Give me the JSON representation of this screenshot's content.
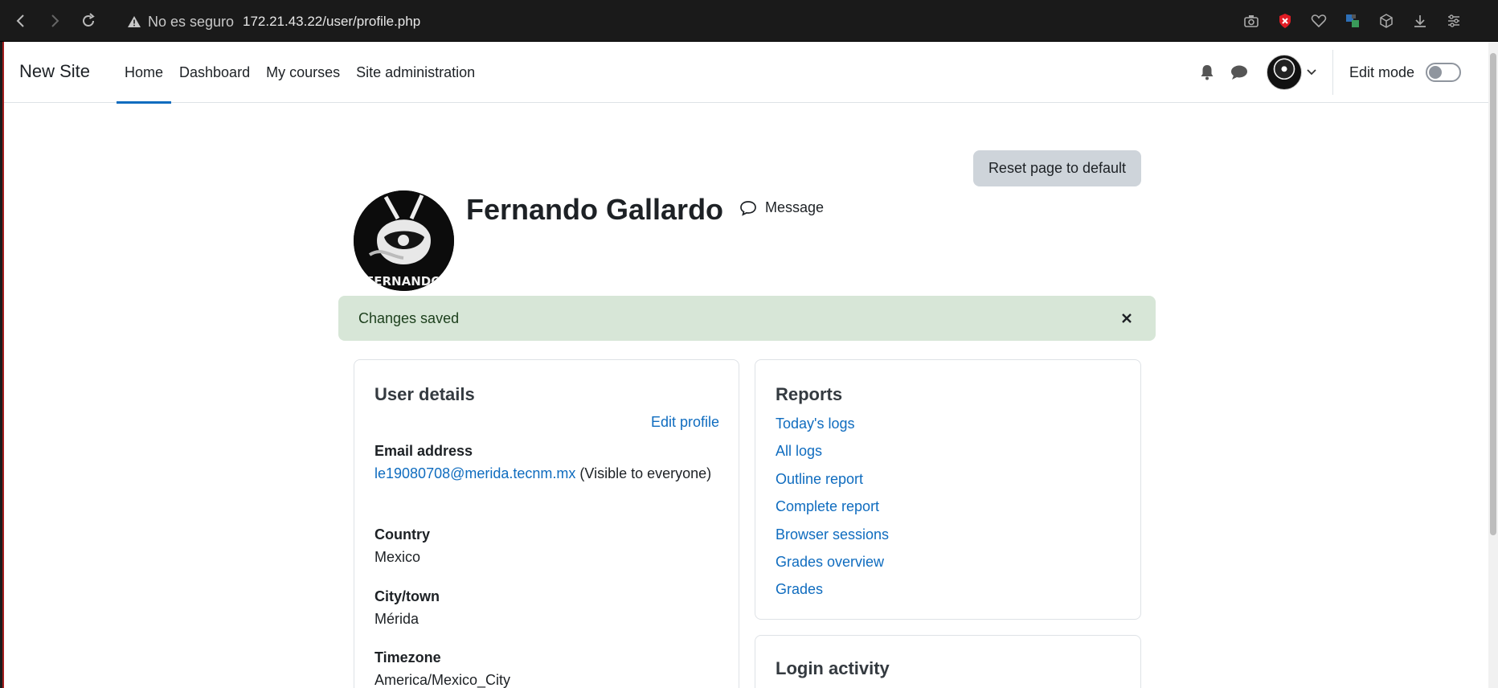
{
  "browser": {
    "security_warning": "No es seguro",
    "url": "172.21.43.22/user/profile.php",
    "icons": [
      "back-icon",
      "forward-icon",
      "reload-icon",
      "camera-icon",
      "shield-icon",
      "heart-icon",
      "extension-icon",
      "cube-icon",
      "download-icon",
      "settings-icon"
    ]
  },
  "navbar": {
    "brand": "New Site",
    "links": [
      {
        "label": "Home",
        "active": true
      },
      {
        "label": "Dashboard",
        "active": false
      },
      {
        "label": "My courses",
        "active": false
      },
      {
        "label": "Site administration",
        "active": false
      }
    ],
    "edit_mode_label": "Edit mode",
    "edit_mode_on": false
  },
  "page": {
    "reset_button": "Reset page to default",
    "user_name": "Fernando Gallardo",
    "message_label": "Message",
    "alert_text": "Changes saved"
  },
  "user_details": {
    "title": "User details",
    "edit_profile": "Edit profile",
    "email_label": "Email address",
    "email_value": "le19080708@merida.tecnm.mx",
    "email_visibility": "(Visible to everyone)",
    "country_label": "Country",
    "country_value": "Mexico",
    "city_label": "City/town",
    "city_value": "Mérida",
    "timezone_label": "Timezone",
    "timezone_value": "America/Mexico_City"
  },
  "reports": {
    "title": "Reports",
    "items": [
      "Today's logs",
      "All logs",
      "Outline report",
      "Complete report",
      "Browser sessions",
      "Grades overview",
      "Grades"
    ]
  },
  "login_activity": {
    "title": "Login activity"
  },
  "colors": {
    "link": "#0f6cbf",
    "alert_bg": "#d7e6d7",
    "button_bg": "#ced4da"
  }
}
